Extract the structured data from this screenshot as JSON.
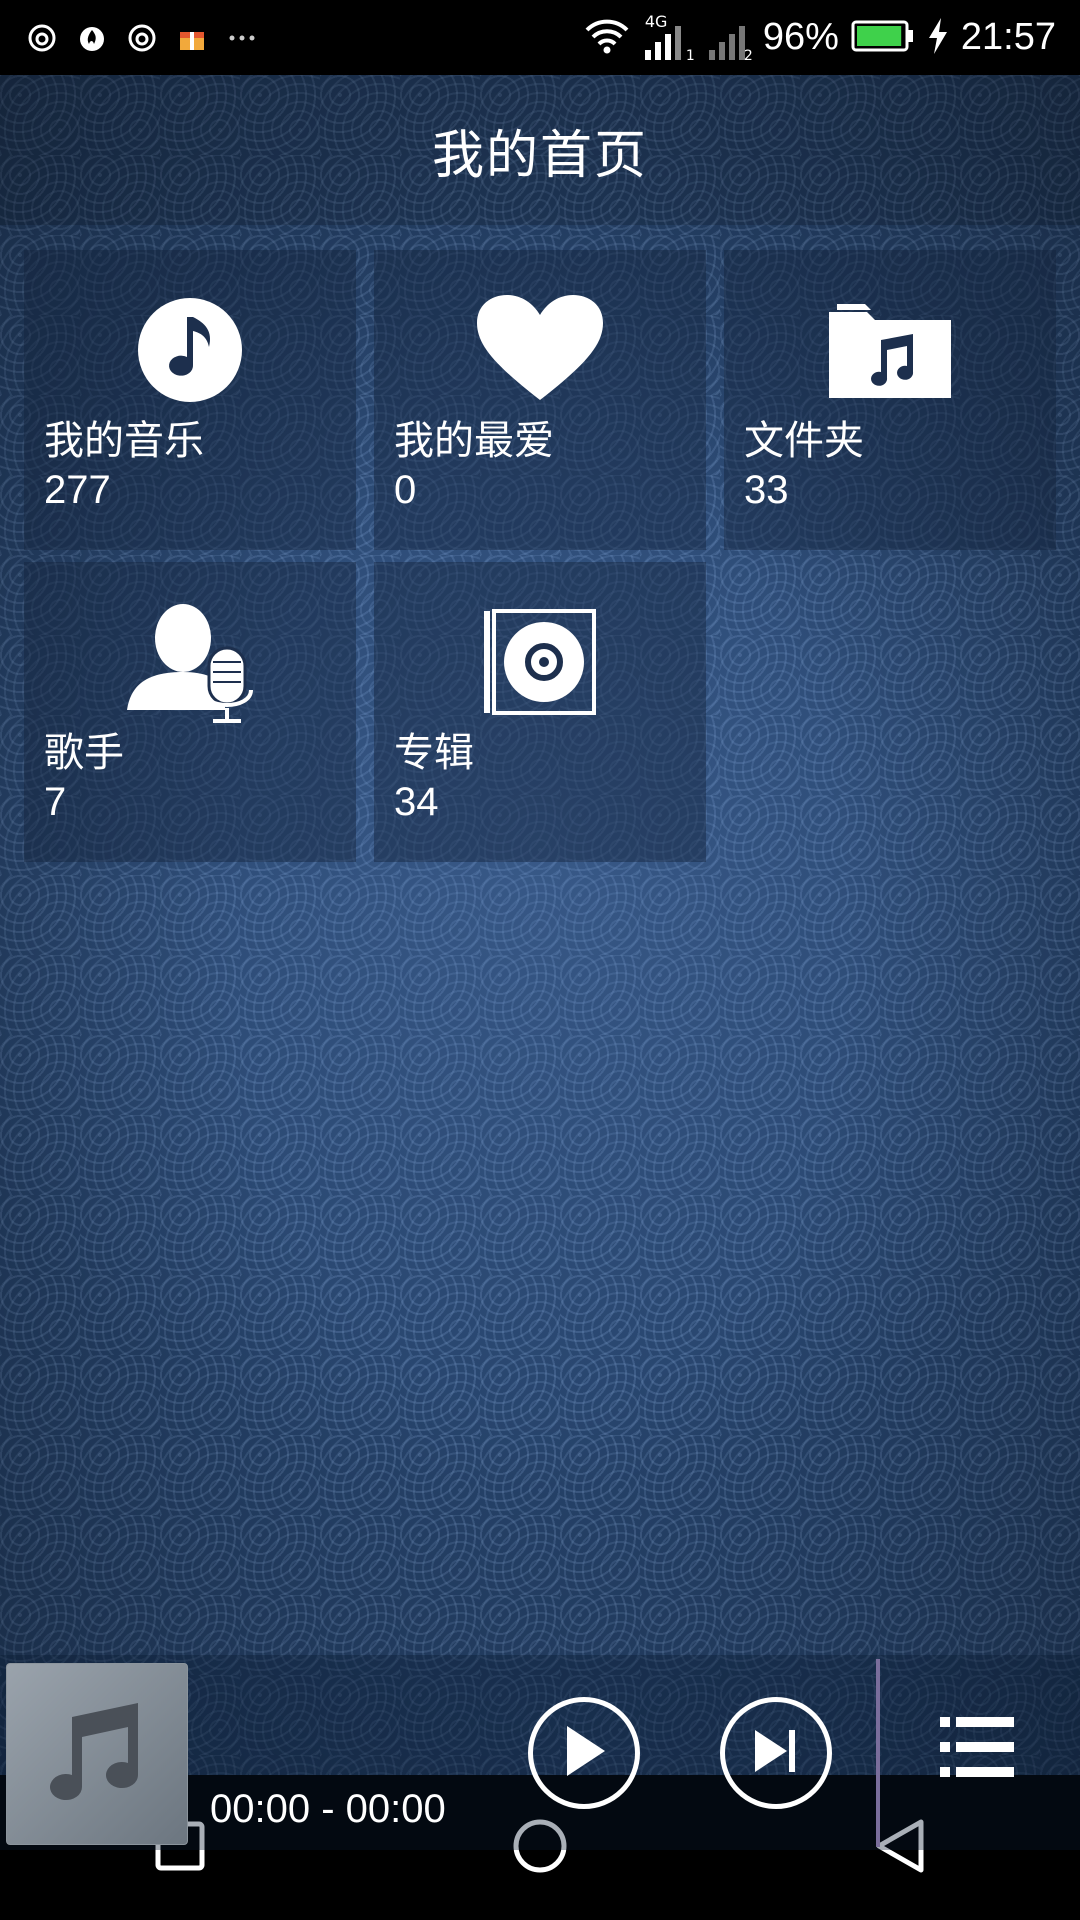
{
  "status_bar": {
    "battery_percent": "96%",
    "time": "21:57",
    "network": "4G",
    "sim1": "1",
    "sim2": "2",
    "battery_fill": 0.96,
    "battery_color": "#3fd14b"
  },
  "header": {
    "title": "我的首页"
  },
  "tiles": [
    {
      "label": "我的音乐",
      "count": "277",
      "icon": "music-note-icon"
    },
    {
      "label": "我的最爱",
      "count": "0",
      "icon": "heart-icon"
    },
    {
      "label": "文件夹",
      "count": "33",
      "icon": "music-folder-icon"
    },
    {
      "label": "歌手",
      "count": "7",
      "icon": "singer-microphone-icon"
    },
    {
      "label": "专辑",
      "count": "34",
      "icon": "album-cd-icon"
    }
  ],
  "player": {
    "time": "00:00 - 00:00",
    "play_icon": "play-icon",
    "next_icon": "skip-next-icon",
    "list_icon": "playlist-icon"
  },
  "nav": {
    "recent": "square-icon",
    "home": "circle-icon",
    "back": "back-triangle-icon"
  },
  "colors": {
    "background": "#26436b",
    "divider": "#7a6e9c"
  }
}
